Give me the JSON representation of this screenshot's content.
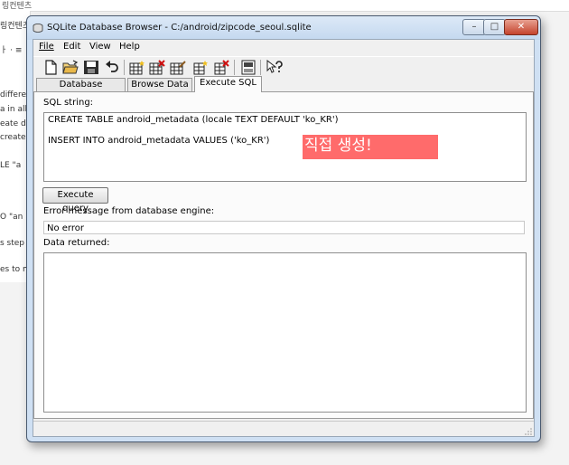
{
  "background": {
    "top_text": "링컨텐츠",
    "left_fragments": [
      "링컨텐츠",
      "ㅏ · ≡",
      "differe",
      "a in all",
      "eate dg",
      "created",
      "LE \"a",
      "O \"an",
      "s step",
      "es to m"
    ]
  },
  "window": {
    "title": "SQLite Database Browser - C:/android/zipcode_seoul.sqlite",
    "min_label": "–",
    "max_label": "□",
    "close_label": "✕"
  },
  "menu": {
    "file": "File",
    "edit": "Edit",
    "view": "View",
    "help": "Help"
  },
  "toolbar_icons": [
    "new-file-icon",
    "open-folder-icon",
    "save-icon",
    "undo-icon",
    "create-table-icon",
    "delete-table-icon",
    "modify-table-icon",
    "create-index-icon",
    "delete-index-icon",
    "log-icon",
    "whats-this-icon"
  ],
  "tabs": [
    {
      "label": "Database Structure",
      "active": false
    },
    {
      "label": "Browse Data",
      "active": false
    },
    {
      "label": "Execute SQL",
      "active": true
    }
  ],
  "execute_sql": {
    "sql_label": "SQL string:",
    "sql_lines": [
      "CREATE TABLE android_metadata (locale TEXT DEFAULT 'ko_KR')",
      "INSERT INTO android_metadata VALUES ('ko_KR')"
    ],
    "annotation": "직접 생성!",
    "execute_button": "Execute query",
    "error_label": "Error message from database engine:",
    "error_value": "No error",
    "data_label": "Data returned:"
  },
  "colors": {
    "annotation_bg": "#ff6b6b",
    "close_button": "#c4432d"
  }
}
